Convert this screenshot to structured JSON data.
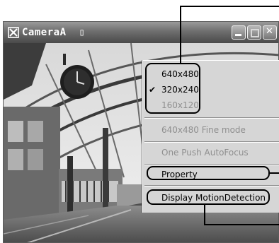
{
  "window": {
    "title": "CameraA",
    "title_glyph": "▯",
    "icon": "camera-app-icon",
    "controls": [
      "minimize-icon",
      "maximize-icon",
      "close-icon"
    ]
  },
  "context_menu": {
    "resolutions": [
      {
        "label": "640x480",
        "checked": false,
        "enabled": true
      },
      {
        "label": "320x240",
        "checked": true,
        "enabled": true
      },
      {
        "label": "160x120",
        "checked": false,
        "enabled": false
      }
    ],
    "check_glyph": "✔",
    "fine_mode_label": "640x480 Fine mode",
    "autofocus_label": "One Push AutoFocus",
    "property_label": "Property",
    "motion_detection_label": "Display MotionDetection"
  }
}
